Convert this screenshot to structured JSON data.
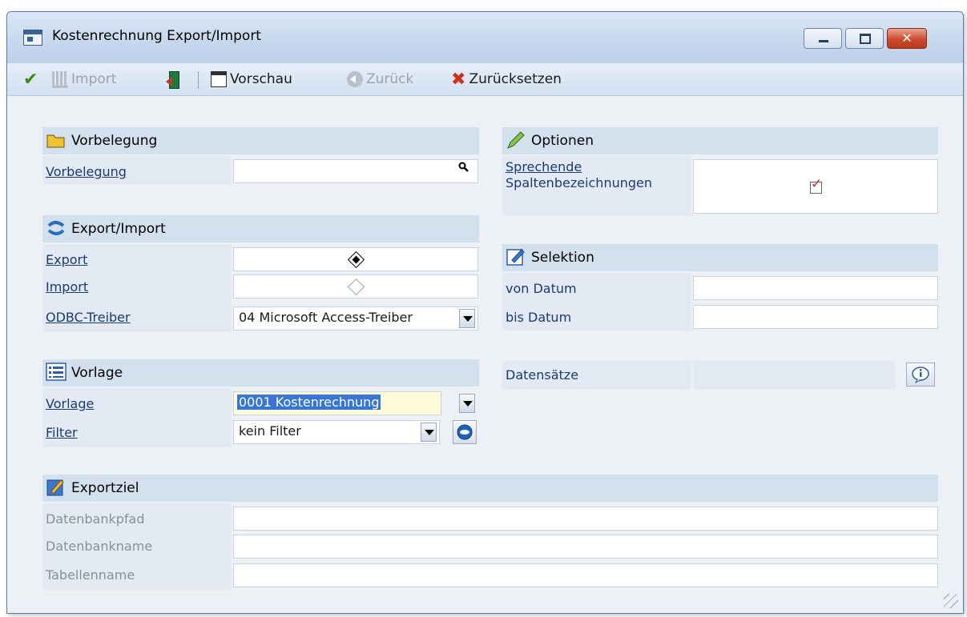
{
  "window": {
    "title": "Kostenrechnung Export/Import"
  },
  "toolbar": {
    "import_label": "Import",
    "preview_label": "Vorschau",
    "back_label": "Zurück",
    "reset_label": "Zurücksetzen"
  },
  "vorbelegung": {
    "section_title": "Vorbelegung",
    "label": "Vorbelegung",
    "value": ""
  },
  "export_import": {
    "section_title": "Export/Import",
    "export_label": "Export",
    "import_label": "Import",
    "odbc_label": "ODBC-Treiber",
    "odbc_value": "04 Microsoft Access-Treiber"
  },
  "vorlage": {
    "section_title": "Vorlage",
    "vorlage_label": "Vorlage",
    "vorlage_value": "0001 Kostenrechnung",
    "filter_label": "Filter",
    "filter_value": "kein Filter"
  },
  "exportziel": {
    "section_title": "Exportziel",
    "path_label": "Datenbankpfad",
    "name_label": "Datenbankname",
    "table_label": "Tabellenname"
  },
  "optionen": {
    "section_title": "Optionen",
    "spalten_label_1": "Sprechende",
    "spalten_label_2": "Spaltenbezeichnungen",
    "spalten_checked": true
  },
  "selektion": {
    "section_title": "Selektion",
    "von_label": "von Datum",
    "bis_label": "bis Datum",
    "datensaetze_label": "Datensätze"
  },
  "colors": {
    "section_bg": "#d3e0ee",
    "label_blue": "#1b3b73",
    "selection": "#3776d6",
    "accent_red": "#d0301f"
  }
}
